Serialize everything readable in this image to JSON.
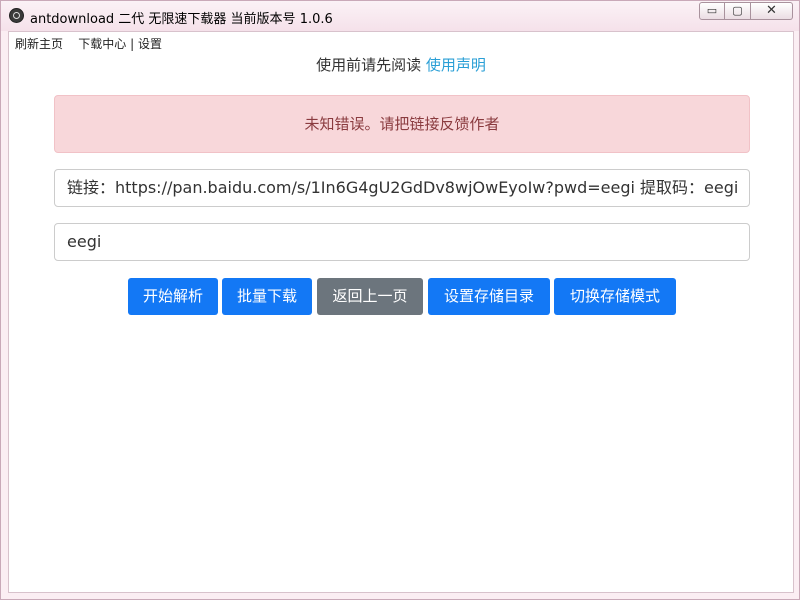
{
  "window": {
    "title": "antdownload 二代 无限速下载器 当前版本号 1.0.6",
    "controls": {
      "minimize": "▭",
      "maximize": "▢",
      "close": "✕"
    }
  },
  "menu": {
    "refresh": "刷新主页",
    "download_center": "下载中心",
    "separator": "|",
    "settings": "设置"
  },
  "notice": {
    "text": "使用前请先阅读",
    "link": "使用声明"
  },
  "alert": {
    "message": "未知错误。请把链接反馈作者"
  },
  "inputs": {
    "link_value": "链接：https://pan.baidu.com/s/1In6G4gU2GdDv8wjOwEyoIw?pwd=eegi  提取码：eegi",
    "code_value": "eegi"
  },
  "buttons": {
    "parse": "开始解析",
    "batch": "批量下载",
    "back": "返回上一页",
    "set_dir": "设置存储目录",
    "switch_mode": "切换存储模式"
  },
  "colors": {
    "primary": "#1378f5",
    "secondary": "#6c757d",
    "alert_bg": "#f8d7da",
    "alert_text": "#8a3b3f",
    "link": "#2a9fd6"
  }
}
